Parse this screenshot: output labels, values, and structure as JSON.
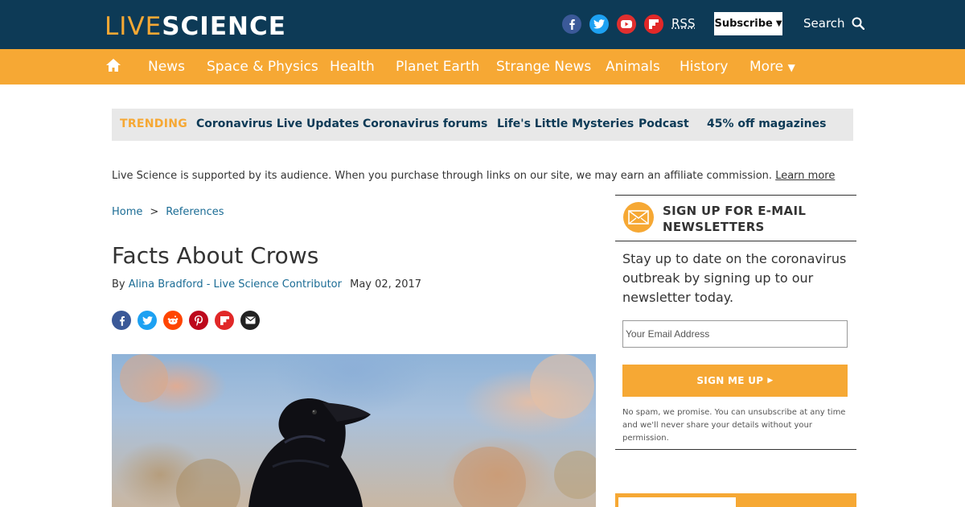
{
  "header": {
    "logo_live": "LIVE",
    "logo_science": "SCIENCE",
    "rss_label": "RSS",
    "subscribe_label": "Subscribe",
    "search_label": "Search",
    "social_icons": [
      "facebook-icon",
      "twitter-icon",
      "youtube-icon",
      "flipboard-icon"
    ]
  },
  "nav": {
    "items": [
      "News",
      "Space & Physics",
      "Health",
      "Planet Earth",
      "Strange News",
      "Animals",
      "History",
      "More"
    ]
  },
  "trending": {
    "label": "TRENDING",
    "links": [
      "Coronavirus Live Updates",
      "Coronavirus forums",
      "Life's Little Mysteries",
      "Podcast",
      "45% off magazines"
    ]
  },
  "affiliate": {
    "text": "Live Science is supported by its audience. When you purchase through links on our site, we may earn an affiliate commission.",
    "link": "Learn more"
  },
  "breadcrumb": {
    "items": [
      "Home",
      "References"
    ],
    "separator": ">"
  },
  "article": {
    "title": "Facts About Crows",
    "by": "By",
    "author": "Alina Bradford - Live Science Contributor",
    "date": "May 02, 2017",
    "share_icons": [
      "facebook-icon",
      "twitter-icon",
      "reddit-icon",
      "pinterest-icon",
      "flipboard-icon",
      "email-icon"
    ]
  },
  "newsletter": {
    "title": "SIGN UP FOR E-MAIL NEWSLETTERS",
    "text": "Stay up to date on the coronavirus outbreak by signing up to our newsletter today.",
    "placeholder": "Your Email Address",
    "button": "SIGN ME UP",
    "fine_print": "No spam, we promise. You can unsubscribe at any time and we'll never share your details without your permission."
  },
  "colors": {
    "header_bg": "#0d3a56",
    "accent": "#f6a834",
    "link": "#1b6c95",
    "trending_bg": "#e8e8e8"
  }
}
